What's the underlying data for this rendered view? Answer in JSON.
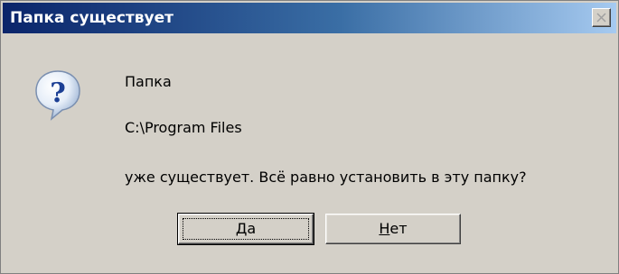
{
  "dialog": {
    "title": "Папка существует",
    "message_line_1": "Папка",
    "message_line_2": "C:\\Program Files",
    "message_line_3": "уже существует. Всё равно установить в эту папку?"
  },
  "buttons": {
    "yes": {
      "accel": "Д",
      "rest": "а"
    },
    "no": {
      "accel": "Н",
      "rest": "ет"
    }
  },
  "icons": {
    "message_icon": "question-icon",
    "close": "close-icon"
  },
  "colors": {
    "titlebar_start": "#0a246a",
    "titlebar_end": "#a6caf0",
    "face": "#d4d0c8"
  }
}
